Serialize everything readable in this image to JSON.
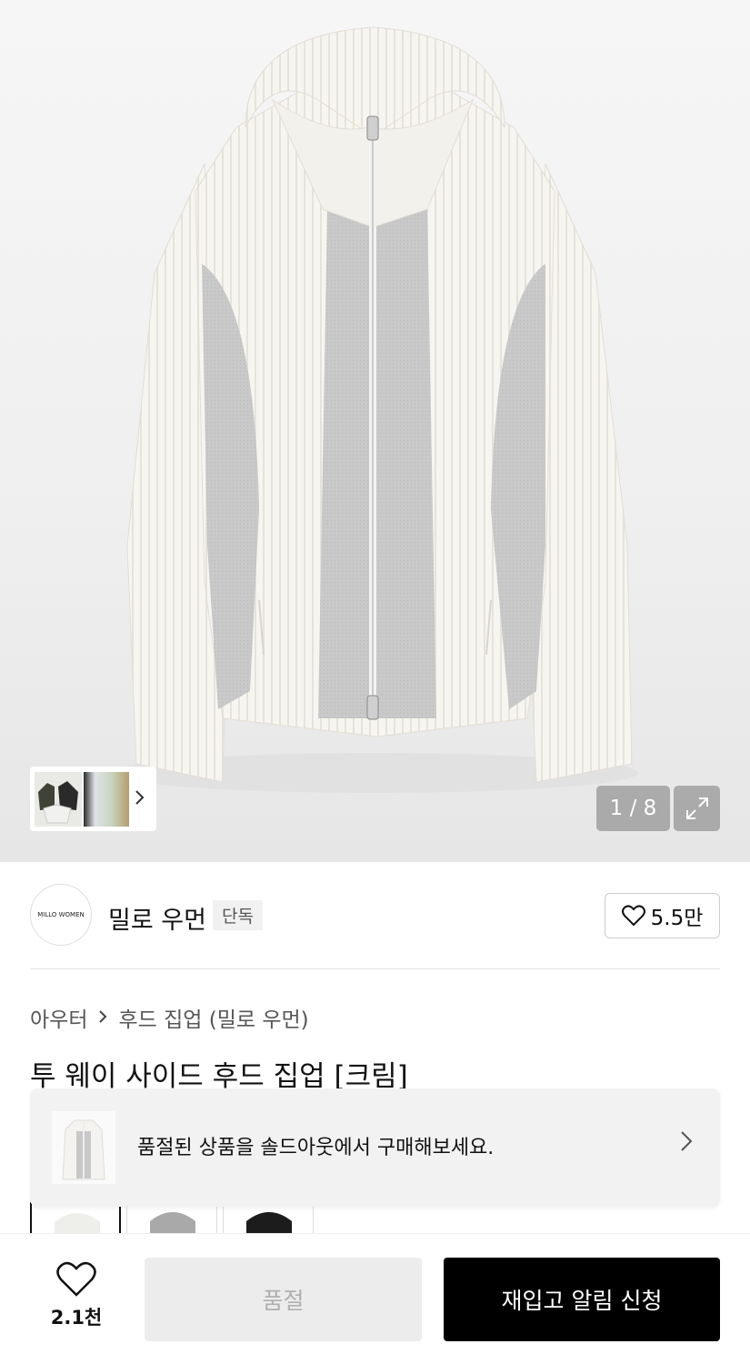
{
  "gallery": {
    "counter": "1 / 8",
    "image_icon": "hoodie-product-photo",
    "expand_icon": "expand-icon",
    "thumbnail_arrow_icon": "chevron-right-icon"
  },
  "brand": {
    "logo_text": "MILLO WOMEN",
    "name": "밀로 우먼",
    "badge": "단독",
    "like_count": "5.5만"
  },
  "breadcrumb": {
    "category": "아우터",
    "subcategory": "후드 집업 (밀로 우먼)"
  },
  "product": {
    "title": "투 웨이 사이드 후드 집업 [크림]"
  },
  "soldout_banner": {
    "text": "품절된 상품을 솔드아웃에서 구매해보세요."
  },
  "bottom_bar": {
    "wish_count": "2.1천",
    "soldout_label": "품절",
    "restock_label": "재입고 알림 신청"
  },
  "colors": {
    "primary_button": "#000000",
    "disabled_button": "#ececec"
  }
}
